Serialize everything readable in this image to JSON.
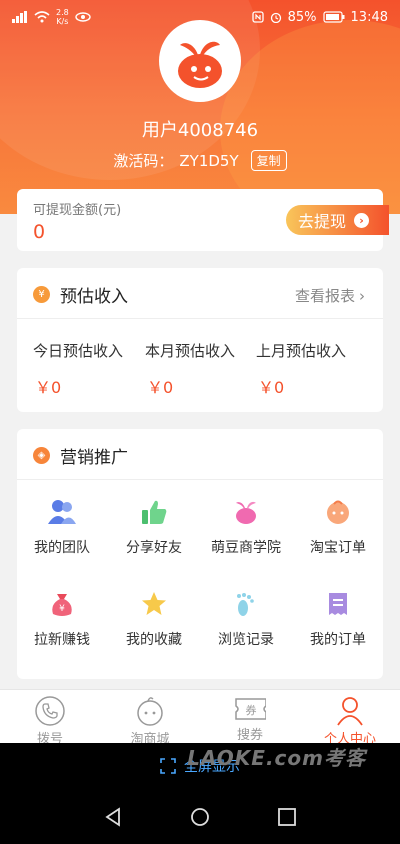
{
  "statusbar": {
    "speed_value": "2.8",
    "speed_unit": "K/s",
    "battery": "85%",
    "time": "13:48"
  },
  "profile": {
    "username": "用户4008746",
    "code_label": "激活码：",
    "code_value": "ZY1D5Y",
    "copy_label": "复制"
  },
  "withdraw": {
    "label": "可提现金额(元)",
    "amount": "0",
    "button_label": "去提现"
  },
  "income": {
    "title": "预估收入",
    "report_link": "查看报表",
    "columns": [
      {
        "label": "今日预估收入",
        "value": "￥0"
      },
      {
        "label": "本月预估收入",
        "value": "￥0"
      },
      {
        "label": "上月预估收入",
        "value": "￥0"
      }
    ]
  },
  "promo": {
    "title": "营销推广",
    "items": [
      {
        "label": "我的团队",
        "icon": "team-icon"
      },
      {
        "label": "分享好友",
        "icon": "thumbs-up-icon"
      },
      {
        "label": "萌豆商学院",
        "icon": "bean-icon"
      },
      {
        "label": "淘宝订单",
        "icon": "bun-icon"
      },
      {
        "label": "拉新赚钱",
        "icon": "money-bag-icon"
      },
      {
        "label": "我的收藏",
        "icon": "star-icon"
      },
      {
        "label": "浏览记录",
        "icon": "footprint-icon"
      },
      {
        "label": "我的订单",
        "icon": "receipt-icon"
      }
    ]
  },
  "tabs": [
    {
      "label": "拨号",
      "icon": "phone-icon",
      "active": false
    },
    {
      "label": "淘商城",
      "icon": "mascot-icon",
      "active": false
    },
    {
      "label": "搜券",
      "icon": "coupon-icon",
      "active": false,
      "icon_text": "券"
    },
    {
      "label": "个人中心",
      "icon": "person-icon",
      "active": true
    }
  ],
  "fullscreen_label": "全屏显示",
  "watermark": "LAOKE.com考客",
  "colors": {
    "accent": "#f4522c",
    "gold": "#f9c55a"
  }
}
